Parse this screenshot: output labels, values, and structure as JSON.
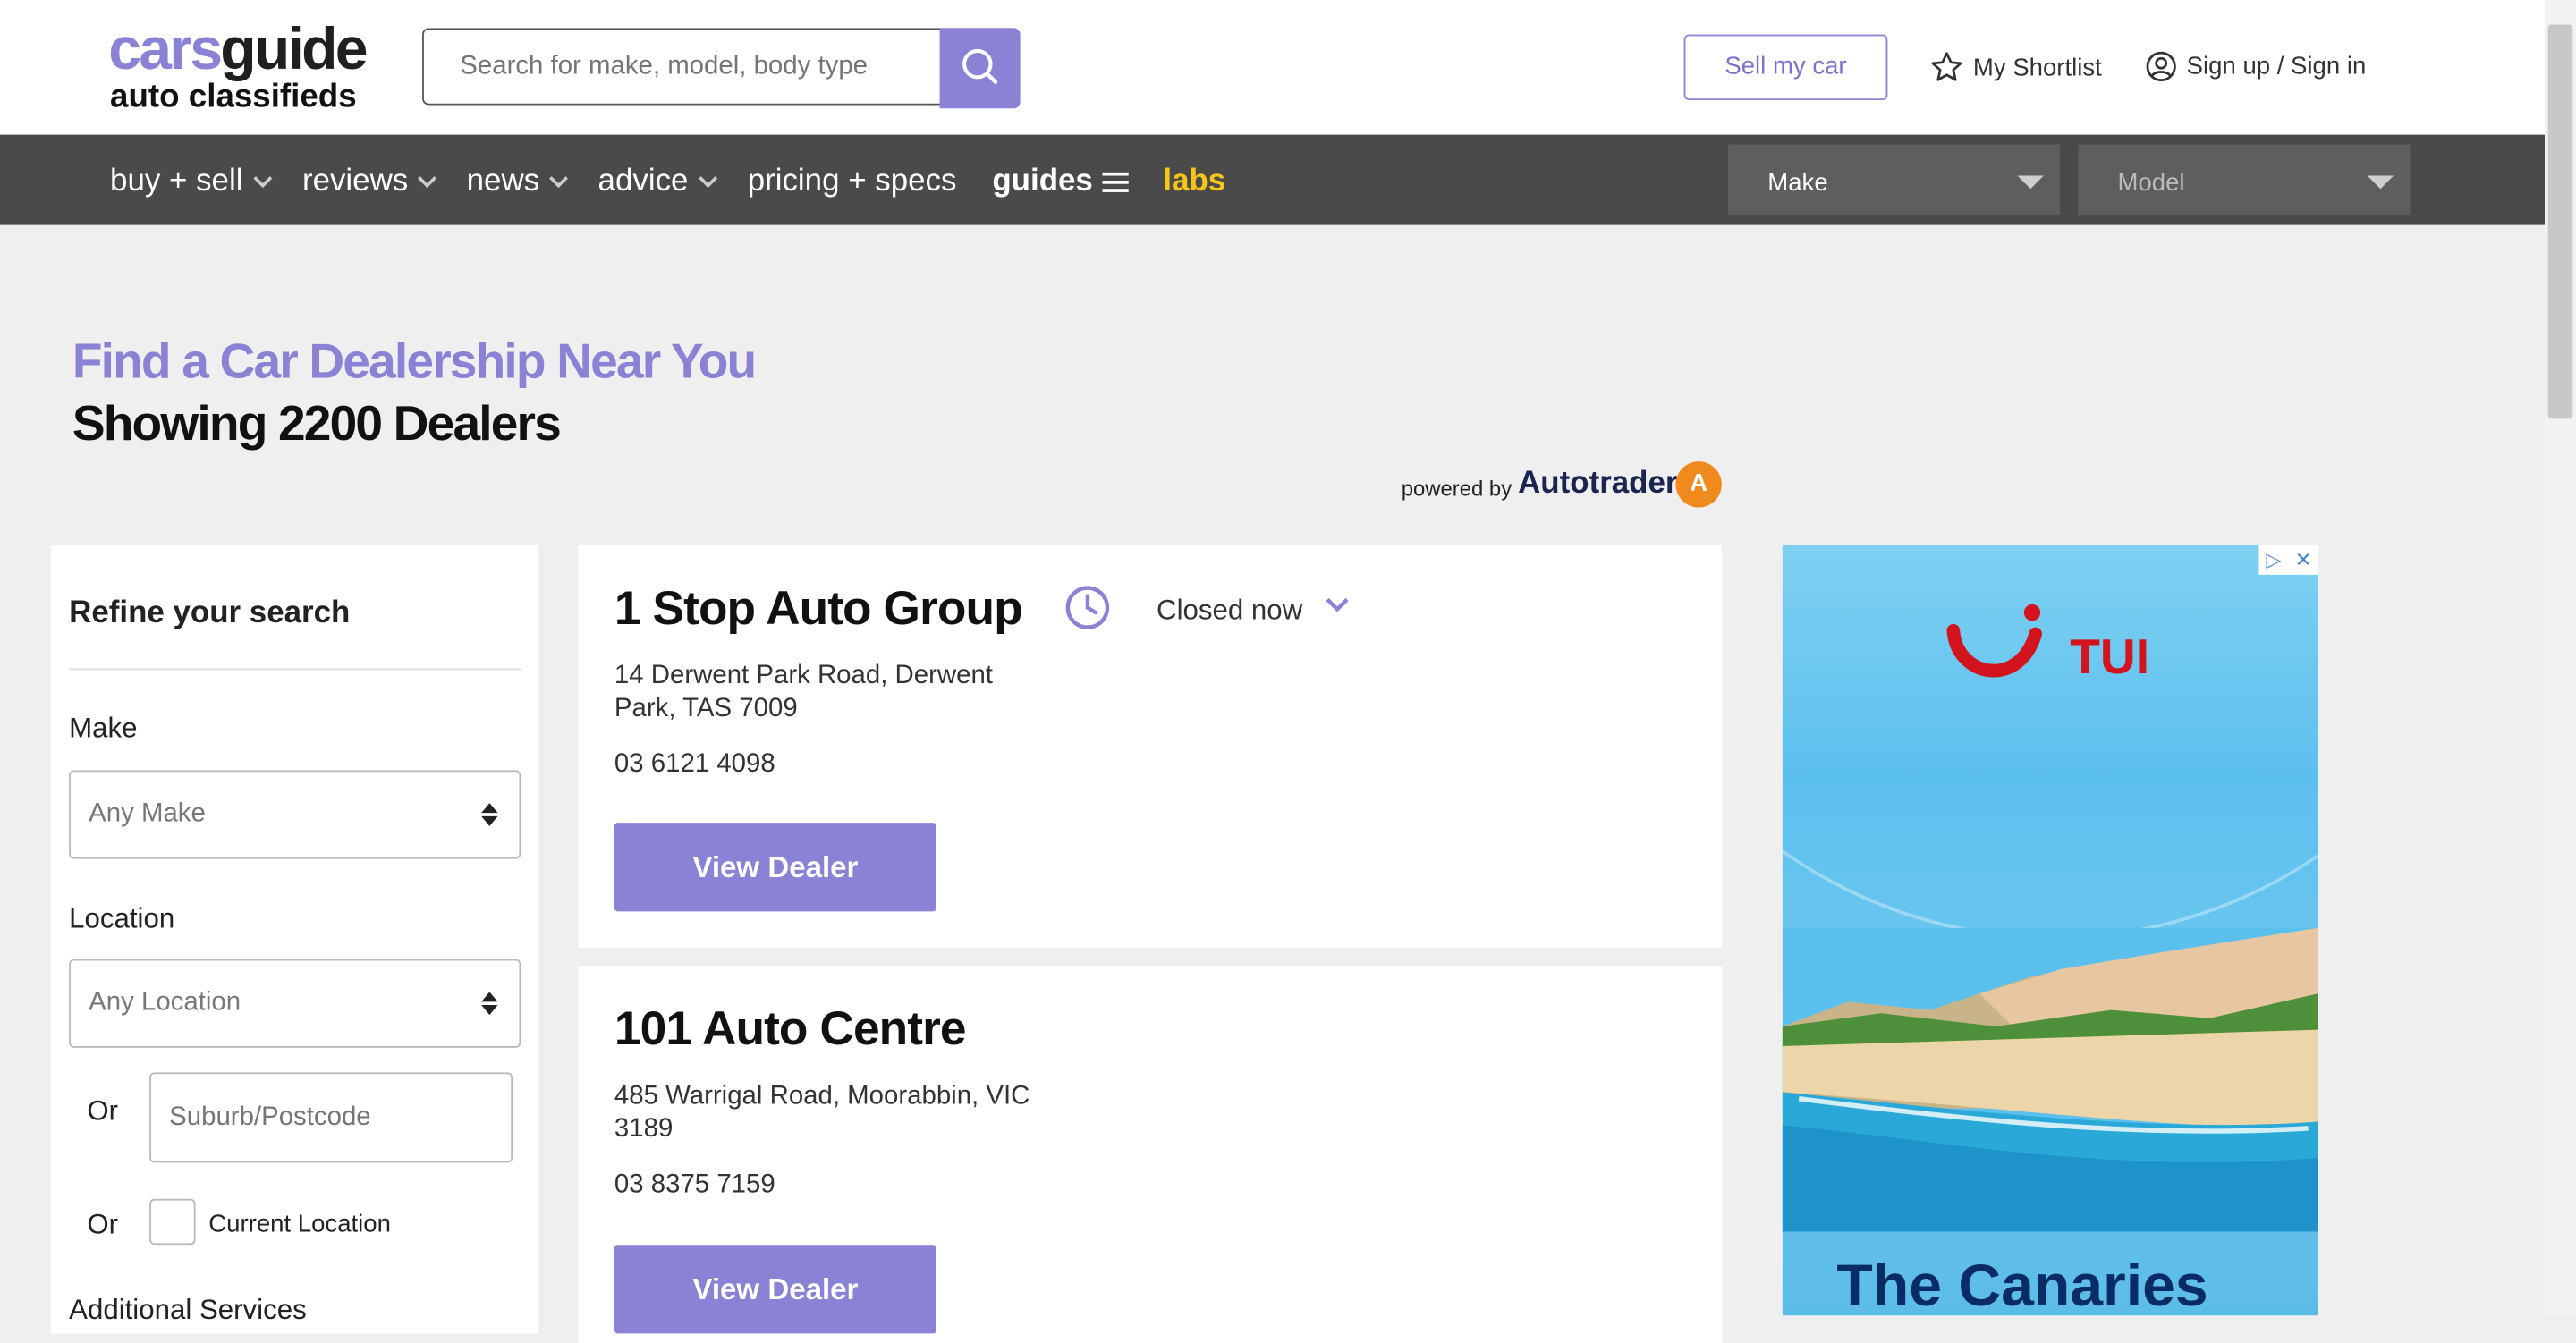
{
  "header": {
    "logo_top_a": "cars",
    "logo_top_b": "guide",
    "logo_bottom": "auto classifieds",
    "search_placeholder": "Search for make, model, body type",
    "sell_label": "Sell my car",
    "shortlist_label": "My Shortlist",
    "signin_label": "Sign up / Sign in"
  },
  "nav": {
    "items": [
      {
        "label": "buy + sell"
      },
      {
        "label": "reviews"
      },
      {
        "label": "news"
      },
      {
        "label": "advice"
      },
      {
        "label": "pricing + specs"
      },
      {
        "label": "guides"
      },
      {
        "label": "labs"
      }
    ],
    "make_select": "Make",
    "model_select": "Model"
  },
  "page": {
    "title": "Find a Car Dealership Near You",
    "subtitle": "Showing 2200 Dealers",
    "powered_by": "powered by",
    "autotrader": "Autotrader",
    "autotrader_logo": "A"
  },
  "filters": {
    "heading": "Refine your search",
    "make_label": "Make",
    "make_value": "Any Make",
    "location_label": "Location",
    "location_value": "Any Location",
    "or_1": "Or",
    "suburb_placeholder": "Suburb/Postcode",
    "or_2": "Or",
    "current_location": "Current Location",
    "additional_services": "Additional Services"
  },
  "dealers": [
    {
      "name": "1 Stop Auto Group",
      "status": "Closed now",
      "address": "14 Derwent Park Road, Derwent Park, TAS 7009",
      "phone": "03 6121 4098",
      "button": "View Dealer"
    },
    {
      "name": "101 Auto Centre",
      "address": "485 Warrigal Road, Moorabbin, VIC 3189",
      "phone": "03 8375 7159",
      "button": "View Dealer"
    }
  ],
  "ad": {
    "brand": "TUI",
    "headline": "The Canaries"
  },
  "colors": {
    "brand_purple": "#8a82d4",
    "nav_bg": "#4a4a4a",
    "page_bg": "#efefef"
  }
}
